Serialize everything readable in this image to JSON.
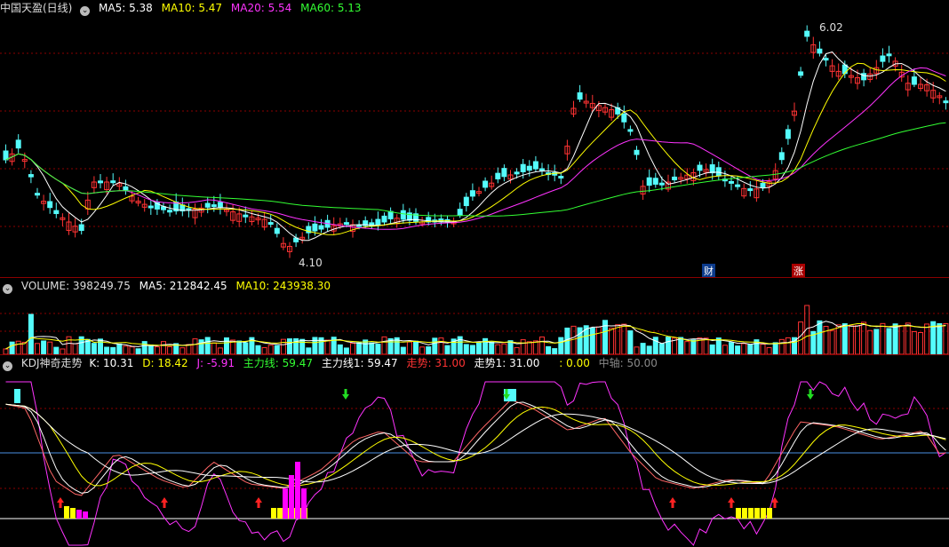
{
  "price_panel": {
    "title": "中国天盈(日线)",
    "indicators": [
      {
        "label": "MA5: 5.38",
        "color": "#ffffff"
      },
      {
        "label": "MA10: 5.47",
        "color": "#ffff00"
      },
      {
        "label": "MA20: 5.54",
        "color": "#ff33ff"
      },
      {
        "label": "MA60: 5.13",
        "color": "#33ff33"
      }
    ],
    "high_label": "6.02",
    "low_label": "4.10",
    "marker_cai": "财",
    "marker_zhang": "涨"
  },
  "volume_panel": {
    "title": "VOLUME: 398249.75",
    "indicators": [
      {
        "label": "MA5: 212842.45",
        "color": "#ffffff"
      },
      {
        "label": "MA10: 243938.30",
        "color": "#ffff00"
      }
    ]
  },
  "kdj_panel": {
    "title": "KDJ神奇走势",
    "indicators": [
      {
        "label": "K: 10.31",
        "color": "#ffffff"
      },
      {
        "label": "D: 18.42",
        "color": "#ffff00"
      },
      {
        "label": "J: -5.91",
        "color": "#ff33ff"
      },
      {
        "label": "主力线: 59.47",
        "color": "#33ff33"
      },
      {
        "label": "主力线1: 59.47",
        "color": "#ffffff"
      },
      {
        "label": "走势: 31.00",
        "color": "#ff3333"
      },
      {
        "label": "走势1: 31.00",
        "color": "#ffffff"
      },
      {
        "label": ": 0.00",
        "color": "#ffff00"
      },
      {
        "label": "中轴: 50.00",
        "color": "#888888"
      }
    ]
  },
  "colors": {
    "up": "#ff3333",
    "down": "#54fcfc",
    "grid": "#8b0000"
  }
}
